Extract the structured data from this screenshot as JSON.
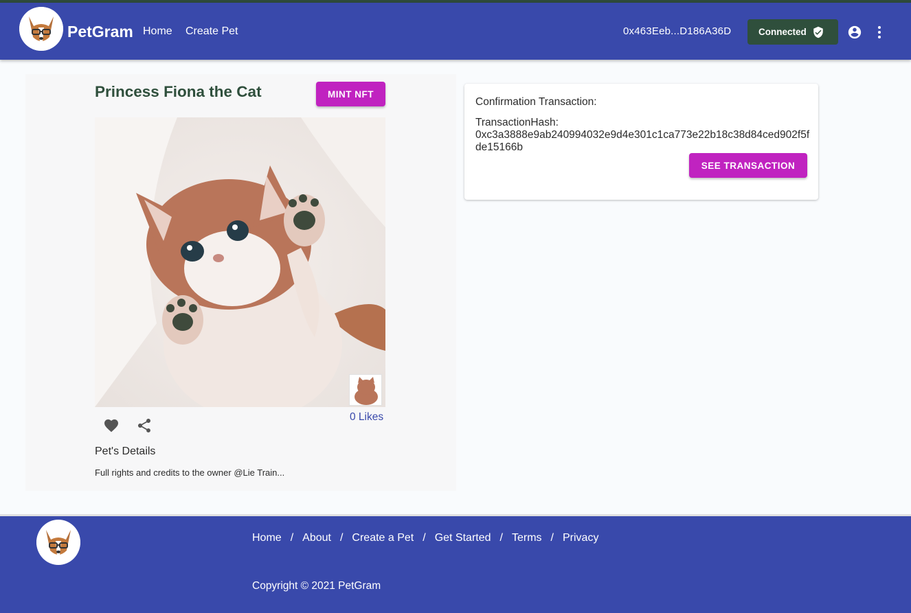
{
  "header": {
    "brand": "PetGram",
    "nav": {
      "home": "Home",
      "create_pet": "Create Pet"
    },
    "wallet_address": "0x463Eeb...D186A36D",
    "connected_label": "Connected",
    "icons": [
      "dog-logo-icon",
      "shield-check-icon",
      "account-circle-icon",
      "more-vert-icon"
    ]
  },
  "pet": {
    "name": "Princess Fiona the Cat",
    "mint_label": "MINT NFT",
    "likes": "0 Likes",
    "details_title": "Pet's Details",
    "details_text": "Full rights and credits to the owner @Lie Train..."
  },
  "transaction": {
    "label": "Confirmation Transaction:",
    "hash_label": "TransactionHash:",
    "hash": "0xc3a3888e9ab240994032e9d4e301c1ca773e22b18c38d84ced902f5fde15166b",
    "button_label": "SEE TRANSACTION"
  },
  "footer": {
    "links": [
      "Home",
      "About",
      "Create a Pet",
      "Get Started",
      "Terms",
      "Privacy"
    ],
    "separator": "/",
    "copyright": "Copyright © 2021 PetGram"
  },
  "colors": {
    "primary": "#3949ab",
    "accent": "#c023c0",
    "connected": "#2f4f3c",
    "title": "#2f4f3c"
  }
}
